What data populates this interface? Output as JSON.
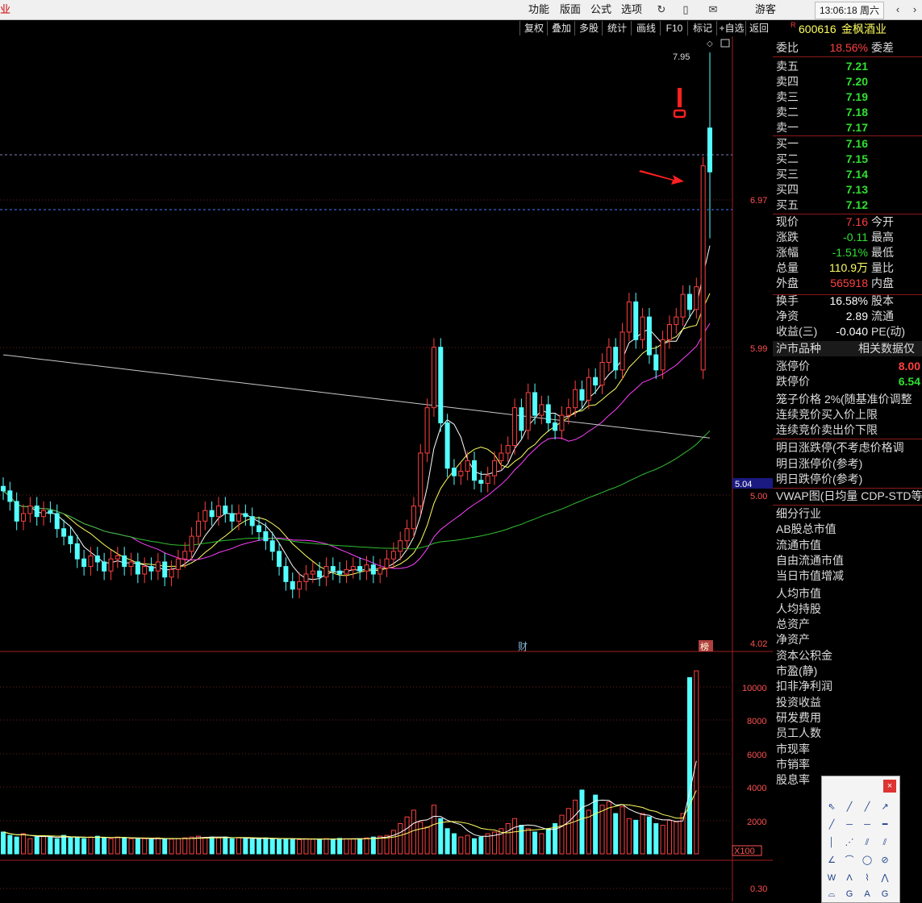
{
  "menu": {
    "left_fragment": "业",
    "items": [
      "功能",
      "版面",
      "公式",
      "选项"
    ],
    "guest": "游客",
    "clock": "13:06:18 周六"
  },
  "toolbar": {
    "buttons": [
      "复权",
      "叠加",
      "多股",
      "统计",
      "画线",
      "F10",
      "标记",
      "+自选",
      "返回"
    ]
  },
  "chart": {
    "price_labels": [
      "6.97",
      "5.99",
      "5.00",
      "4.02"
    ],
    "high_label": "7.95",
    "current_box": "5.04",
    "volume_labels": [
      "10000",
      "8000",
      "6000",
      "4000",
      "2000"
    ],
    "volume_unit": "X100",
    "indicator_label": "0.30",
    "marker_cai": "财",
    "marker_bang": "榜",
    "colors": {
      "up": "#ff4040",
      "down": "#54ffff",
      "ma_white": "#ffffff",
      "ma_yellow": "#ffff60",
      "ma_magenta": "#ff40ff",
      "ma_green": "#30c030",
      "ma_long": "#c8c8c8"
    }
  },
  "chart_data": {
    "type": "candlestick",
    "y_range": [
      4.02,
      7.95
    ],
    "closes": [
      5.05,
      4.98,
      4.85,
      4.9,
      4.95,
      4.88,
      4.92,
      4.9,
      4.8,
      4.75,
      4.7,
      4.6,
      4.55,
      4.62,
      4.58,
      4.52,
      4.6,
      4.62,
      4.55,
      4.58,
      4.5,
      4.55,
      4.52,
      4.58,
      4.48,
      4.53,
      4.6,
      4.65,
      4.75,
      4.85,
      4.92,
      4.88,
      4.95,
      4.9,
      4.85,
      4.9,
      4.88,
      4.82,
      4.78,
      4.72,
      4.65,
      4.55,
      4.45,
      4.4,
      4.45,
      4.5,
      4.52,
      4.48,
      4.55,
      4.52,
      4.5,
      4.53,
      4.55,
      4.52,
      4.56,
      4.5,
      4.54,
      4.6,
      4.65,
      4.72,
      4.8,
      4.95,
      5.3,
      5.6,
      6.0,
      5.5,
      5.2,
      5.15,
      5.18,
      5.25,
      5.12,
      5.1,
      5.15,
      5.25,
      5.3,
      5.35,
      5.6,
      5.45,
      5.7,
      5.55,
      5.62,
      5.5,
      5.45,
      5.55,
      5.6,
      5.72,
      5.65,
      5.8,
      5.75,
      5.9,
      6.0,
      5.85,
      6.1,
      6.3,
      6.05,
      6.2,
      5.95,
      5.85,
      6.05,
      6.15,
      6.2,
      6.35,
      6.25,
      6.4,
      7.2,
      7.16
    ],
    "volumes": [
      1300,
      1100,
      1000,
      1200,
      900,
      1000,
      1050,
      1000,
      900,
      1100,
      950,
      1000,
      900,
      1000,
      1050,
      950,
      900,
      1000,
      950,
      900,
      880,
      900,
      850,
      950,
      900,
      880,
      900,
      950,
      1000,
      1050,
      980,
      1000,
      950,
      1000,
      900,
      950,
      900,
      880,
      900,
      950,
      900,
      850,
      880,
      900,
      850,
      900,
      880,
      850,
      900,
      880,
      920,
      900,
      880,
      900,
      950,
      1000,
      1050,
      1100,
      1400,
      1800,
      2200,
      2600,
      1900,
      1600,
      2900,
      2100,
      1500,
      1200,
      1000,
      1100,
      900,
      1000,
      1200,
      1300,
      1500,
      1800,
      2100,
      1700,
      1500,
      1300,
      1200,
      1500,
      1800,
      2300,
      2700,
      3200,
      3800,
      2600,
      3500,
      2900,
      3100,
      2400,
      2800,
      2100,
      2000,
      2400,
      2200,
      1800,
      1700,
      2000,
      1900,
      2400,
      10500,
      10900
    ],
    "ylabel": "",
    "xlabel": ""
  },
  "panel": {
    "code": "600616",
    "name": "金枫酒业",
    "r_badge": "R",
    "weibi_label": "委比",
    "weibi_value": "18.56%",
    "weicha_label": "委差",
    "sells": [
      {
        "label": "卖五",
        "price": "7.21"
      },
      {
        "label": "卖四",
        "price": "7.20"
      },
      {
        "label": "卖三",
        "price": "7.19"
      },
      {
        "label": "卖二",
        "price": "7.18"
      },
      {
        "label": "卖一",
        "price": "7.17"
      }
    ],
    "buys": [
      {
        "label": "买一",
        "price": "7.16"
      },
      {
        "label": "买二",
        "price": "7.15"
      },
      {
        "label": "买三",
        "price": "7.14"
      },
      {
        "label": "买四",
        "price": "7.13"
      },
      {
        "label": "买五",
        "price": "7.12"
      }
    ],
    "quote": [
      {
        "label": "现价",
        "value": "7.16",
        "label2": "今开",
        "color": "#ff4040"
      },
      {
        "label": "涨跌",
        "value": "-0.11",
        "label2": "最高",
        "color": "#30e030"
      },
      {
        "label": "涨幅",
        "value": "-1.51%",
        "label2": "最低",
        "color": "#30e030"
      },
      {
        "label": "总量",
        "value": "110.9万",
        "label2": "量比",
        "color": "#ffff60"
      },
      {
        "label": "外盘",
        "value": "565918",
        "label2": "内盘",
        "color": "#ff4040"
      }
    ],
    "fund": [
      {
        "label": "换手",
        "value": "16.58%",
        "label2": "股本"
      },
      {
        "label": "净资",
        "value": "2.89",
        "label2": "流通"
      },
      {
        "label": "收益(三)",
        "value": "-0.040",
        "label2": "PE(动)"
      }
    ],
    "market_header_left": "沪市品种",
    "market_header_right": "相关数据仅",
    "limit_up_label": "涨停价",
    "limit_up_value": "8.00",
    "limit_down_label": "跌停价",
    "limit_down_value": "6.54",
    "cage_label": "笼子价格",
    "cage_pct": "2%",
    "cage_note": "(随基准价调整",
    "cont_buy": "连续竞价买入价上限",
    "cont_sell": "连续竞价卖出价下限",
    "next_limit": "明日涨跌停(不考虑价格调",
    "next_up": "明日涨停价(参考)",
    "next_down": "明日跌停价(参考)",
    "vwap": "VWAP图(日均量 CDP-STD等",
    "items": [
      "细分行业",
      "AB股总市值",
      "流通市值",
      "自由流通市值",
      "当日市值增减",
      "人均市值",
      "人均持股",
      "总资产",
      "净资产",
      "资本公积金",
      "市盈(静)",
      "扣非净利润",
      "投资收益",
      "研发费用",
      "员工人数",
      "市现率",
      "市销率",
      "股息率"
    ]
  },
  "drawtool": {
    "close_label": "×"
  }
}
